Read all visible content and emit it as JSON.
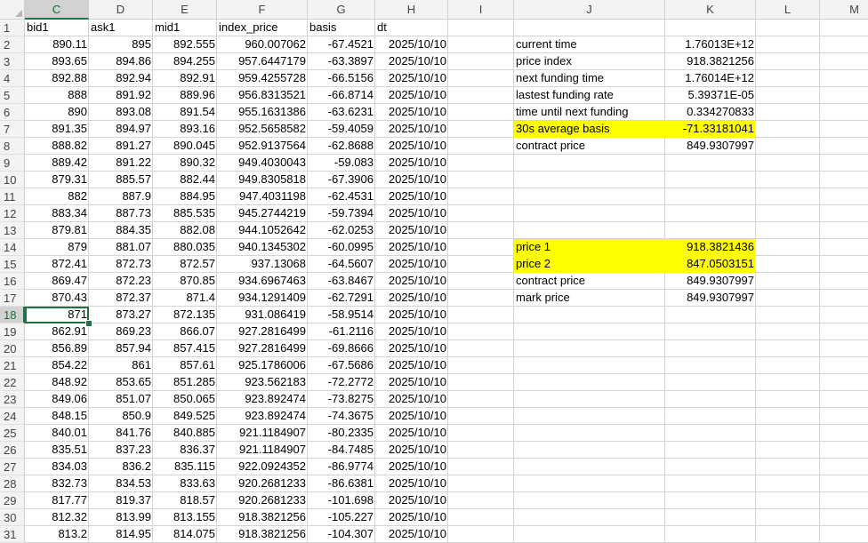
{
  "columns": [
    "C",
    "D",
    "E",
    "F",
    "G",
    "H",
    "I",
    "J",
    "K",
    "L",
    "M"
  ],
  "selected_column": "C",
  "selected_row": "18",
  "active_cell": {
    "col": "C",
    "row": "18"
  },
  "row_numbers": [
    "1",
    "2",
    "3",
    "4",
    "5",
    "6",
    "7",
    "8",
    "9",
    "10",
    "11",
    "12",
    "13",
    "14",
    "15",
    "16",
    "17",
    "18",
    "19",
    "20",
    "21",
    "22",
    "23",
    "24",
    "25",
    "26",
    "27",
    "28",
    "29",
    "30",
    "31"
  ],
  "headers": [
    "bid1",
    "ask1",
    "mid1",
    "index_price",
    "basis",
    "dt"
  ],
  "rows": [
    [
      "890.11",
      "895",
      "892.555",
      "960.007062",
      "-67.4521",
      "2025/10/10"
    ],
    [
      "893.65",
      "894.86",
      "894.255",
      "957.6447179",
      "-63.3897",
      "2025/10/10"
    ],
    [
      "892.88",
      "892.94",
      "892.91",
      "959.4255728",
      "-66.5156",
      "2025/10/10"
    ],
    [
      "888",
      "891.92",
      "889.96",
      "956.8313521",
      "-66.8714",
      "2025/10/10"
    ],
    [
      "890",
      "893.08",
      "891.54",
      "955.1631386",
      "-63.6231",
      "2025/10/10"
    ],
    [
      "891.35",
      "894.97",
      "893.16",
      "952.5658582",
      "-59.4059",
      "2025/10/10"
    ],
    [
      "888.82",
      "891.27",
      "890.045",
      "952.9137564",
      "-62.8688",
      "2025/10/10"
    ],
    [
      "889.42",
      "891.22",
      "890.32",
      "949.4030043",
      "-59.083",
      "2025/10/10"
    ],
    [
      "879.31",
      "885.57",
      "882.44",
      "949.8305818",
      "-67.3906",
      "2025/10/10"
    ],
    [
      "882",
      "887.9",
      "884.95",
      "947.4031198",
      "-62.4531",
      "2025/10/10"
    ],
    [
      "883.34",
      "887.73",
      "885.535",
      "945.2744219",
      "-59.7394",
      "2025/10/10"
    ],
    [
      "879.81",
      "884.35",
      "882.08",
      "944.1052642",
      "-62.0253",
      "2025/10/10"
    ],
    [
      "879",
      "881.07",
      "880.035",
      "940.1345302",
      "-60.0995",
      "2025/10/10"
    ],
    [
      "872.41",
      "872.73",
      "872.57",
      "937.13068",
      "-64.5607",
      "2025/10/10"
    ],
    [
      "869.47",
      "872.23",
      "870.85",
      "934.6967463",
      "-63.8467",
      "2025/10/10"
    ],
    [
      "870.43",
      "872.37",
      "871.4",
      "934.1291409",
      "-62.7291",
      "2025/10/10"
    ],
    [
      "871",
      "873.27",
      "872.135",
      "931.086419",
      "-58.9514",
      "2025/10/10"
    ],
    [
      "862.91",
      "869.23",
      "866.07",
      "927.2816499",
      "-61.2116",
      "2025/10/10"
    ],
    [
      "856.89",
      "857.94",
      "857.415",
      "927.2816499",
      "-69.8666",
      "2025/10/10"
    ],
    [
      "854.22",
      "861",
      "857.61",
      "925.1786006",
      "-67.5686",
      "2025/10/10"
    ],
    [
      "848.92",
      "853.65",
      "851.285",
      "923.562183",
      "-72.2772",
      "2025/10/10"
    ],
    [
      "849.06",
      "851.07",
      "850.065",
      "923.892474",
      "-73.8275",
      "2025/10/10"
    ],
    [
      "848.15",
      "850.9",
      "849.525",
      "923.892474",
      "-74.3675",
      "2025/10/10"
    ],
    [
      "840.01",
      "841.76",
      "840.885",
      "921.1184907",
      "-80.2335",
      "2025/10/10"
    ],
    [
      "835.51",
      "837.23",
      "836.37",
      "921.1184907",
      "-84.7485",
      "2025/10/10"
    ],
    [
      "834.03",
      "836.2",
      "835.115",
      "922.0924352",
      "-86.9774",
      "2025/10/10"
    ],
    [
      "832.73",
      "834.53",
      "833.63",
      "920.2681233",
      "-86.6381",
      "2025/10/10"
    ],
    [
      "817.77",
      "819.37",
      "818.57",
      "920.2681233",
      "-101.698",
      "2025/10/10"
    ],
    [
      "812.32",
      "813.99",
      "813.155",
      "918.3821256",
      "-105.227",
      "2025/10/10"
    ],
    [
      "813.2",
      "814.95",
      "814.075",
      "918.3821256",
      "-104.307",
      "2025/10/10"
    ]
  ],
  "side_panel": [
    {
      "row": "2",
      "label": "current time",
      "value": "1.76013E+12",
      "highlight": false
    },
    {
      "row": "3",
      "label": "price index",
      "value": "918.3821256",
      "highlight": false
    },
    {
      "row": "4",
      "label": "next funding time",
      "value": "1.76014E+12",
      "highlight": false
    },
    {
      "row": "5",
      "label": "lastest funding rate",
      "value": "5.39371E-05",
      "highlight": false
    },
    {
      "row": "6",
      "label": "time until next funding",
      "value": "0.334270833",
      "highlight": false
    },
    {
      "row": "7",
      "label": "30s average basis",
      "value": "-71.33181041",
      "highlight": true
    },
    {
      "row": "8",
      "label": "contract price",
      "value": "849.9307997",
      "highlight": false
    },
    {
      "row": "14",
      "label": "price 1",
      "value": "918.3821436",
      "highlight": true
    },
    {
      "row": "15",
      "label": "price 2",
      "value": "847.0503151",
      "highlight": true
    },
    {
      "row": "16",
      "label": "contract price",
      "value": "849.9307997",
      "highlight": false
    },
    {
      "row": "17",
      "label": "mark price",
      "value": "849.9307997",
      "highlight": false
    }
  ],
  "colors": {
    "highlight": "#ffff00",
    "selection": "#217346",
    "header_bg": "#f3f3f3",
    "gridline": "#d4d4d4"
  }
}
